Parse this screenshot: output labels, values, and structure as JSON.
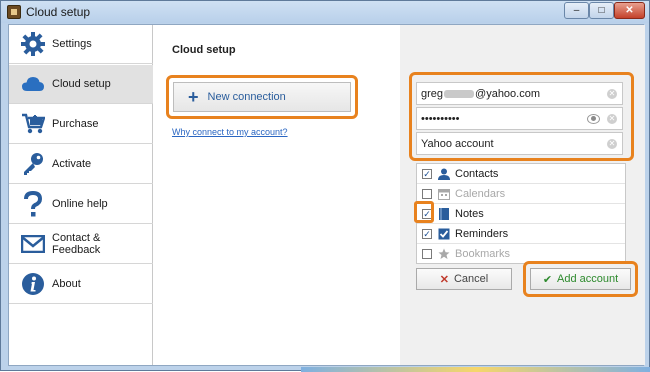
{
  "window": {
    "title": "Cloud setup",
    "min": "–",
    "max": "□",
    "close": "✕"
  },
  "sidebar": {
    "items": [
      {
        "label": "Settings",
        "icon": "gear-icon"
      },
      {
        "label": "Cloud setup",
        "icon": "cloud-icon",
        "active": true
      },
      {
        "label": "Purchase",
        "icon": "cart-icon"
      },
      {
        "label": "Activate",
        "icon": "key-icon"
      },
      {
        "label": "Online help",
        "icon": "question-icon"
      },
      {
        "label": "Contact &",
        "label2": "Feedback",
        "icon": "envelope-icon"
      },
      {
        "label": "About",
        "icon": "info-icon"
      }
    ]
  },
  "main": {
    "title": "Cloud setup",
    "new_connection": "New connection",
    "why_link": "Why connect to my account?"
  },
  "account": {
    "email_prefix": "greg",
    "email_suffix": "@yahoo.com",
    "password_mask": "••••••••••",
    "name": "Yahoo account"
  },
  "sync": [
    {
      "label": "Contacts",
      "checked": true,
      "enabled": true
    },
    {
      "label": "Calendars",
      "checked": false,
      "enabled": false
    },
    {
      "label": "Notes",
      "checked": true,
      "enabled": true
    },
    {
      "label": "Reminders",
      "checked": true,
      "enabled": true
    },
    {
      "label": "Bookmarks",
      "checked": false,
      "enabled": false
    }
  ],
  "buttons": {
    "cancel": "Cancel",
    "add": "Add account"
  },
  "colors": {
    "highlight": "#e8821e",
    "accent": "#2a5d9c",
    "link": "#2a66c2"
  }
}
